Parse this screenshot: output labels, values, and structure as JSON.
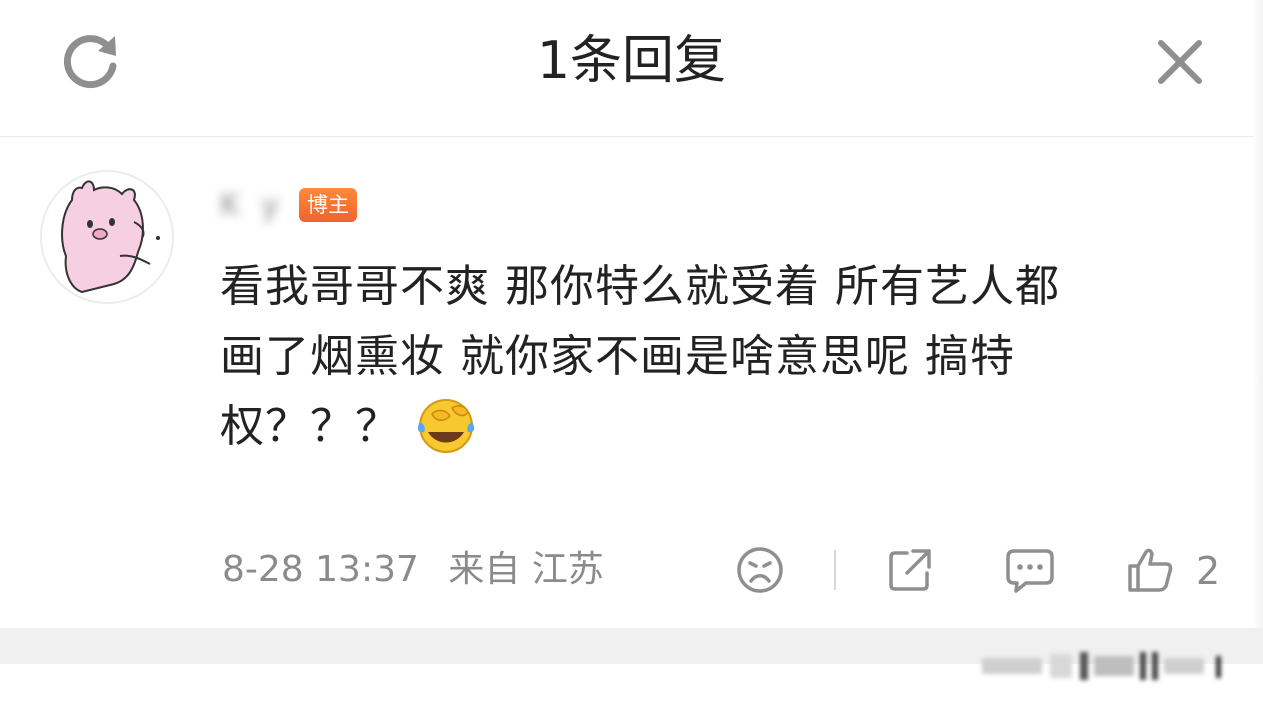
{
  "header": {
    "title": "1条回复",
    "refresh_icon": "refresh-icon",
    "close_icon": "close-icon"
  },
  "comment": {
    "username": "K  y",
    "badge": "博主",
    "text_line1": "看我哥哥不爽 那你特么就受着 所有艺人都",
    "text_line2": "画了烟熏妆 就你家不画是啥意思呢 搞特",
    "text_line3": "权？？？",
    "emoji": "laugh-cry-emoji",
    "timestamp": "8-28 13:37",
    "location": "来自 江苏",
    "like_count": "2"
  },
  "colors": {
    "badge": "#f0632a",
    "text": "#222222",
    "meta": "#8b8b8b",
    "emoji_face": "#f7c82f",
    "emoji_tears": "#5aa7ef"
  }
}
